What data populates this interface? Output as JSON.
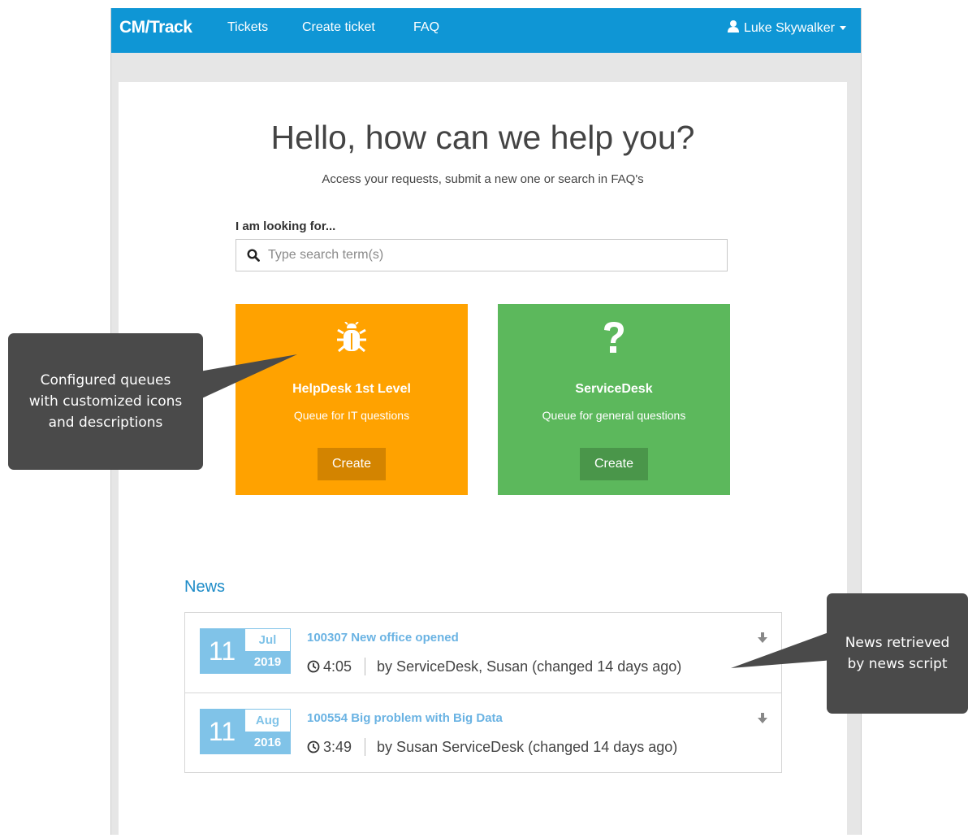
{
  "navbar": {
    "brand": "CM/Track",
    "links": [
      "Tickets",
      "Create ticket",
      "FAQ"
    ],
    "user": "Luke Skywalker"
  },
  "hero": {
    "title": "Hello, how can we help you?",
    "subtitle": "Access your requests, submit a new one or search in FAQ's"
  },
  "search": {
    "label": "I am looking for...",
    "placeholder": "Type search term(s)",
    "value": ""
  },
  "queues": [
    {
      "icon": "bug-icon",
      "title": "HelpDesk 1st Level",
      "description": "Queue for IT questions",
      "button": "Create",
      "color": "#ffa200",
      "button_color": "#d38400"
    },
    {
      "icon": "question-mark-icon",
      "title": "ServiceDesk",
      "description": "Queue for general questions",
      "button": "Create",
      "color": "#5cb85c",
      "button_color": "#4a964a"
    }
  ],
  "news": {
    "heading": "News",
    "items": [
      {
        "day": "11",
        "month": "Jul",
        "year": "2019",
        "title": "100307 New office opened",
        "time": "4:05",
        "author": "by ServiceDesk, Susan (changed 14 days ago)"
      },
      {
        "day": "11",
        "month": "Aug",
        "year": "2016",
        "title": "100554 Big problem with Big Data",
        "time": "3:49",
        "author": "by Susan ServiceDesk (changed 14 days ago)"
      }
    ]
  },
  "callouts": {
    "queues": "Configured queues\nwith customized icons\nand descriptions",
    "news": "News retrieved\nby news script"
  },
  "colors": {
    "navbar": "#0f96d5",
    "accent": "#1e8cc8",
    "callout": "#4a4a4a"
  }
}
